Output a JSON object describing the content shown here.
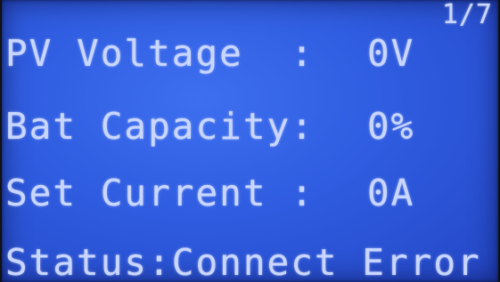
{
  "display": {
    "page_indicator": "1/7",
    "rows": [
      {
        "label": "PV Voltage  :",
        "value": "0V"
      },
      {
        "label": "Bat Capacity:",
        "value": "0%"
      },
      {
        "label": "Set Current :",
        "value": "0A"
      }
    ],
    "status_line": "Status:Connect Error"
  },
  "colors": {
    "screen_background": "#2f5ce0",
    "text": "#c9d6ff"
  }
}
